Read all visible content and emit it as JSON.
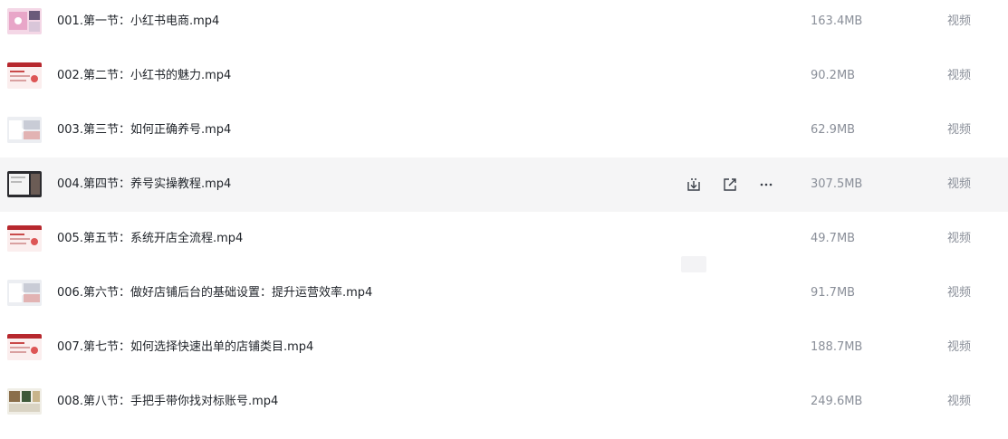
{
  "files": [
    {
      "name": "001.第一节：小红书电商.mp4",
      "size": "163.4MB",
      "type": "视频",
      "thumb": "pink"
    },
    {
      "name": "002.第二节：小红书的魅力.mp4",
      "size": "90.2MB",
      "type": "视频",
      "thumb": "red"
    },
    {
      "name": "003.第三节：如何正确养号.mp4",
      "size": "62.9MB",
      "type": "视频",
      "thumb": "slide"
    },
    {
      "name": "004.第四节：养号实操教程.mp4",
      "size": "307.5MB",
      "type": "视频",
      "thumb": "dark"
    },
    {
      "name": "005.第五节：系统开店全流程.mp4",
      "size": "49.7MB",
      "type": "视频",
      "thumb": "red"
    },
    {
      "name": "006.第六节：做好店铺后台的基础设置：提升运营效率.mp4",
      "size": "91.7MB",
      "type": "视频",
      "thumb": "slide"
    },
    {
      "name": "007.第七节：如何选择快速出单的店铺类目.mp4",
      "size": "188.7MB",
      "type": "视频",
      "thumb": "red"
    },
    {
      "name": "008.第八节：手把手带你找对标账号.mp4",
      "size": "249.6MB",
      "type": "视频",
      "thumb": "photo"
    }
  ],
  "hover_row_index": 3,
  "row_actions": [
    "download-icon",
    "share-icon",
    "more-icon"
  ]
}
